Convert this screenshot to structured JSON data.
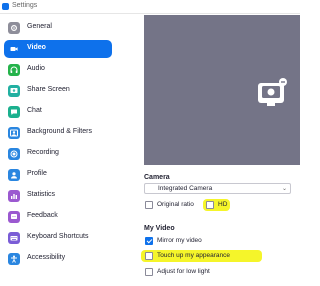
{
  "window": {
    "title": "Settings"
  },
  "sidebar": {
    "items": [
      {
        "label": "General",
        "icon": "gear-icon",
        "color": "#8e8e9a",
        "active": false
      },
      {
        "label": "Video",
        "icon": "video-camera-icon",
        "color": "#ffffff",
        "active": true
      },
      {
        "label": "Audio",
        "icon": "headphones-icon",
        "color": "#25b34b",
        "active": false
      },
      {
        "label": "Share Screen",
        "icon": "share-screen-icon",
        "color": "#22b0a1",
        "active": false
      },
      {
        "label": "Chat",
        "icon": "chat-icon",
        "color": "#1bb08e",
        "active": false
      },
      {
        "label": "Background & Filters",
        "icon": "background-icon",
        "color": "#2a86e0",
        "active": false
      },
      {
        "label": "Recording",
        "icon": "recording-icon",
        "color": "#2a86e0",
        "active": false
      },
      {
        "label": "Profile",
        "icon": "profile-icon",
        "color": "#2a86e0",
        "active": false
      },
      {
        "label": "Statistics",
        "icon": "statistics-icon",
        "color": "#9b59d0",
        "active": false
      },
      {
        "label": "Feedback",
        "icon": "feedback-icon",
        "color": "#9b59d0",
        "active": false
      },
      {
        "label": "Keyboard Shortcuts",
        "icon": "keyboard-icon",
        "color": "#7a5cd6",
        "active": false
      },
      {
        "label": "Accessibility",
        "icon": "accessibility-icon",
        "color": "#2a86e0",
        "active": false
      }
    ]
  },
  "camera": {
    "heading": "Camera",
    "selected": "Integrated Camera",
    "original_ratio": {
      "label": "Original ratio",
      "checked": false
    },
    "hd": {
      "label": "HD",
      "checked": false
    }
  },
  "my_video": {
    "heading": "My Video",
    "mirror": {
      "label": "Mirror my video",
      "checked": true
    },
    "touch_up": {
      "label": "Touch up my appearance",
      "checked": false
    },
    "low_light": {
      "label": "Adjust for low light",
      "checked": false
    }
  },
  "colors": {
    "accent": "#0e71eb",
    "highlight": "#f5f52a",
    "preview": "#747487"
  }
}
